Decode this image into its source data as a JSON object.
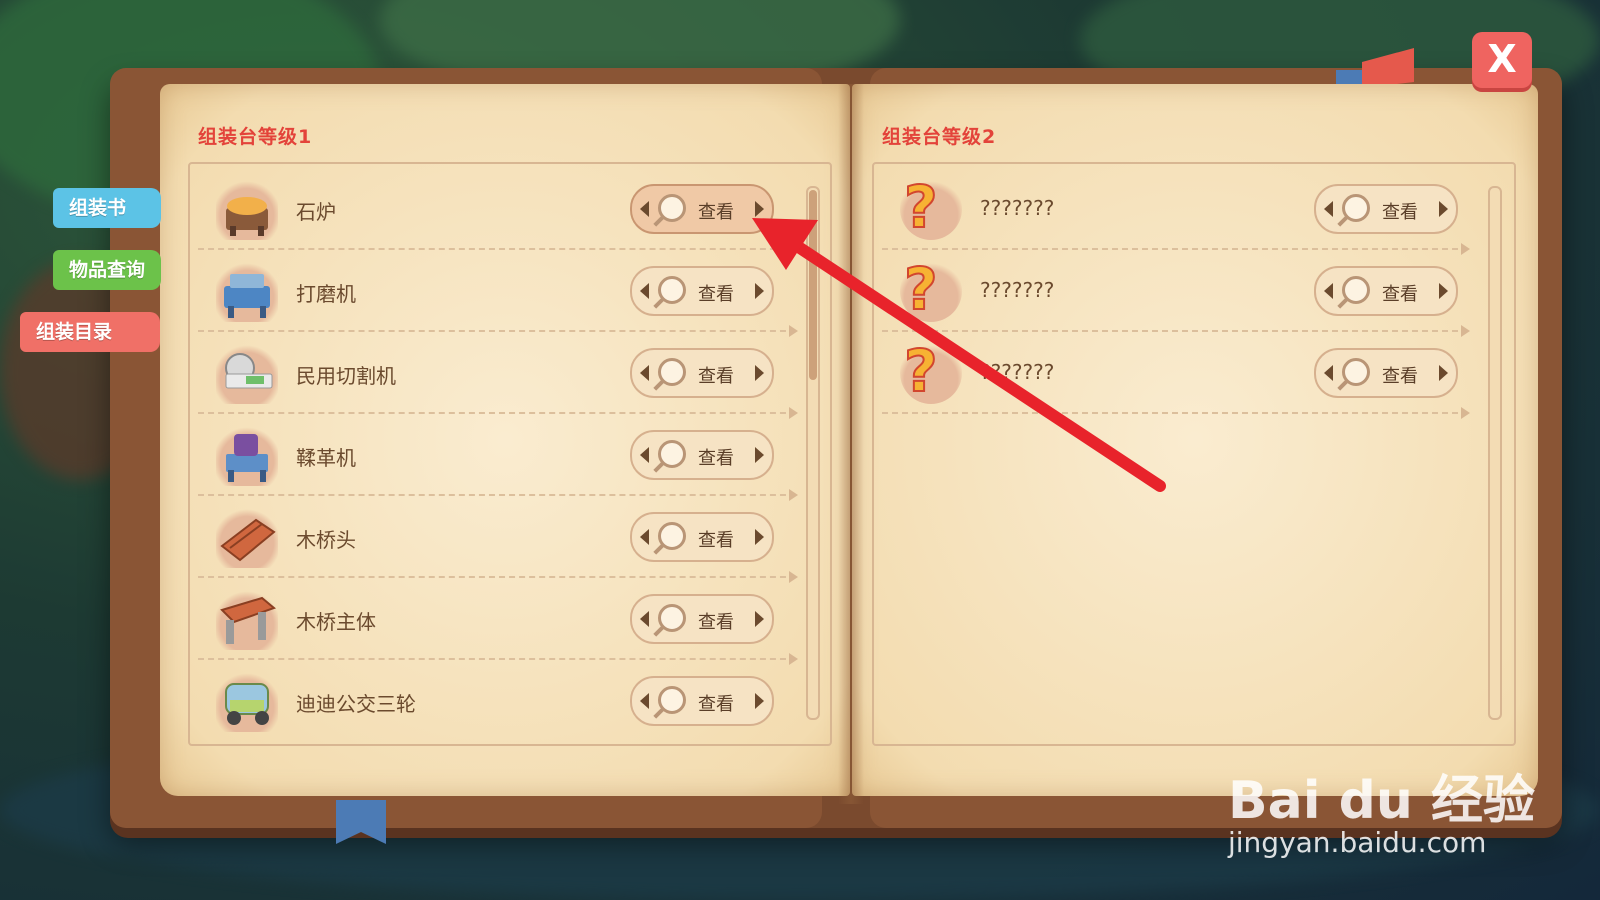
{
  "side_tabs": [
    {
      "label": "组装书",
      "color": "#5cc3e6"
    },
    {
      "label": "物品查询",
      "color": "#6cc24a"
    },
    {
      "label": "组装目录",
      "color": "#f07067"
    }
  ],
  "close_label": "X",
  "left_page": {
    "title": "组装台等级1",
    "items": [
      {
        "name": "石炉",
        "button": "查看",
        "icon": "stone-furnace-icon"
      },
      {
        "name": "打磨机",
        "button": "查看",
        "icon": "grinder-icon"
      },
      {
        "name": "民用切割机",
        "button": "查看",
        "icon": "cutter-icon"
      },
      {
        "name": "鞣革机",
        "button": "查看",
        "icon": "tanning-machine-icon"
      },
      {
        "name": "木桥头",
        "button": "查看",
        "icon": "wooden-bridge-head-icon"
      },
      {
        "name": "木桥主体",
        "button": "查看",
        "icon": "wooden-bridge-body-icon"
      },
      {
        "name": "迪迪公交三轮",
        "button": "查看",
        "icon": "tricycle-icon"
      }
    ]
  },
  "right_page": {
    "title": "组装台等级2",
    "items": [
      {
        "name": "???????",
        "button": "查看",
        "icon": "question-mark-icon"
      },
      {
        "name": "???????",
        "button": "查看",
        "icon": "question-mark-icon"
      },
      {
        "name": "???????",
        "button": "查看",
        "icon": "question-mark-icon"
      }
    ]
  },
  "watermark": {
    "logo": "Bai du 经验",
    "url": "jingyan.baidu.com"
  },
  "colors": {
    "title_red": "#e3433a",
    "arrow_red": "#e8232b",
    "page": "#f7e6c1"
  }
}
